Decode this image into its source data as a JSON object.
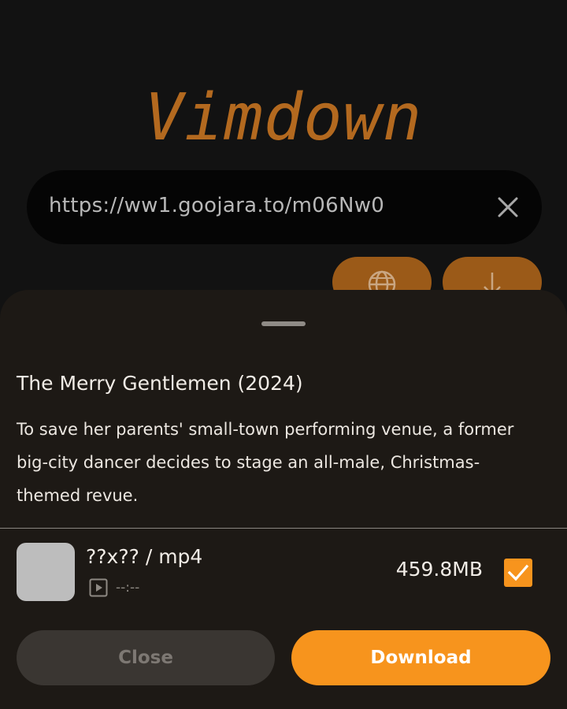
{
  "app": {
    "logo": "Vimdown"
  },
  "url_bar": {
    "value": "https://ww1.goojara.to/m06Nw0",
    "clear_icon": "close-icon"
  },
  "actions": {
    "browser_icon": "globe-icon",
    "download_icon": "arrow-down-icon"
  },
  "sheet": {
    "title": "The Merry Gentlemen (2024)",
    "description": "To save her parents' small-town performing venue, a former big-city dancer decides to stage an all-male, Christmas-themed revue.",
    "item": {
      "format": "??x?? / mp4",
      "duration": "--:--",
      "size": "459.8MB",
      "checked": true
    },
    "close_label": "Close",
    "download_label": "Download"
  },
  "colors": {
    "accent": "#f7941d",
    "logo": "#b3691f",
    "sheet_bg": "#1d1915"
  }
}
